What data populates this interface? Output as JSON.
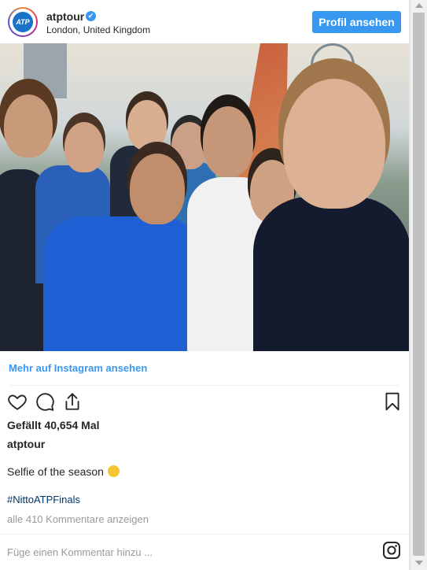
{
  "header": {
    "username": "atptour",
    "verified_mark": "✔",
    "location": "London, United Kingdom",
    "avatar_text": "ATP",
    "profile_button": "Profil ansehen"
  },
  "photo": {
    "description_icon": "group-selfie-photo"
  },
  "links": {
    "more_on_instagram": "Mehr auf Instagram ansehen"
  },
  "actions": {
    "like_icon": "heart-icon",
    "comment_icon": "comment-bubble-icon",
    "share_icon": "share-icon",
    "save_icon": "bookmark-icon"
  },
  "post": {
    "likes": "Gefällt 40,654 Mal",
    "caption_user": "atptour",
    "caption_text": "Selfie of the season",
    "hashtag": "#NittoATPFinals",
    "view_comments": "alle 410 Kommentare anzeigen"
  },
  "comment": {
    "placeholder": "Füge einen Kommentar hinzu ..."
  },
  "colors": {
    "button_blue": "#3897f0",
    "link_blue": "#3897f0",
    "hashtag_color": "#003569",
    "muted_text": "#999999"
  }
}
